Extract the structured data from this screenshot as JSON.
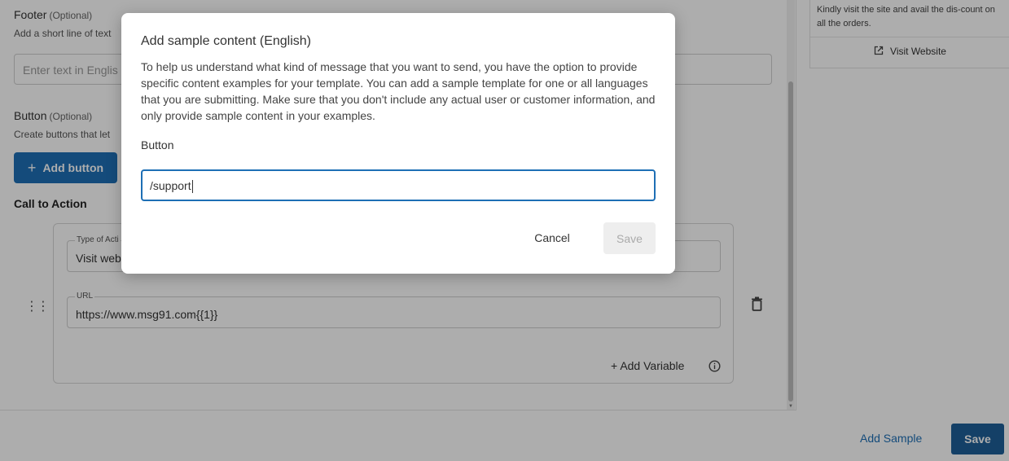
{
  "form": {
    "footer": {
      "label": "Footer",
      "optional": "(Optional)",
      "help": "Add a short line of text",
      "placeholder": "Enter text in Englis"
    },
    "button_section": {
      "label": "Button",
      "optional": "(Optional)",
      "help": "Create buttons that let",
      "add_button_label": "Add button"
    },
    "call_to_action": {
      "title": "Call to Action",
      "type_label": "Type of Acti",
      "type_value": "Visit web",
      "url_label": "URL",
      "url_value": "https://www.msg91.com{{1}}",
      "add_variable_label": "Add Variable"
    }
  },
  "preview": {
    "message": "Kindly visit the site and avail the dis-count on all the orders.",
    "button_label": "Visit Website"
  },
  "bottom_bar": {
    "add_sample_label": "Add Sample",
    "save_label": "Save"
  },
  "modal": {
    "title": "Add sample content (English)",
    "description": "To help us understand what kind of message that you want to send, you have the option to provide specific content examples for your template. You can add a sample template for one or all languages that you are submitting. Make sure that you don't include any actual user or customer information, and only provide sample content in your examples.",
    "field_label": "Button",
    "field_value": "/support",
    "cancel_label": "Cancel",
    "save_label": "Save"
  },
  "colors": {
    "primary": "#1e6fb5",
    "save_primary": "#1e5f99",
    "disabled_bg": "#eeeeee",
    "disabled_text": "#aaaaaa"
  },
  "icons": {
    "plus": "plus-icon",
    "drag": "drag-handle-icon",
    "trash": "trash-icon",
    "info": "info-icon",
    "external": "external-link-icon"
  }
}
